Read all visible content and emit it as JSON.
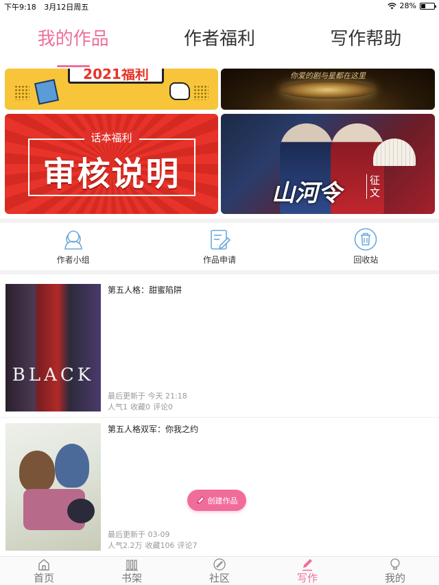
{
  "status_bar": {
    "time": "下午9:18",
    "date": "3月12日周五",
    "battery": "28%"
  },
  "top_tabs": [
    {
      "label": "我的作品",
      "active": true
    },
    {
      "label": "作者福利",
      "active": false
    },
    {
      "label": "写作帮助",
      "active": false
    }
  ],
  "banners": {
    "b1_title": "2021福利",
    "b2_text": "你爱的剧与星都在这里",
    "b3_label": "话本福利",
    "b3_title": "审核说明",
    "b4_title": "山河令",
    "b4_sub": "征文"
  },
  "quick_actions": [
    {
      "label": "作者小组",
      "icon": "author-group-icon"
    },
    {
      "label": "作品申请",
      "icon": "work-apply-icon"
    },
    {
      "label": "回收站",
      "icon": "recycle-bin-icon"
    }
  ],
  "works": [
    {
      "title": "第五人格：甜蜜陷阱",
      "cover_text": "BLACK",
      "updated": "最后更新于 今天 21:18",
      "stats": {
        "popularity": "人气1",
        "favorites": "收藏0",
        "comments": "评论0"
      }
    },
    {
      "title": "第五人格双军：你我之约",
      "updated": "最后更新于 03-09",
      "stats": {
        "popularity": "人气2.2万",
        "favorites": "收藏106",
        "comments": "评论7"
      }
    }
  ],
  "create_button": {
    "label": "创建作品",
    "icon": "pencil-icon"
  },
  "bottom_nav": [
    {
      "label": "首页",
      "icon": "home-icon",
      "active": false
    },
    {
      "label": "书架",
      "icon": "bookshelf-icon",
      "active": false
    },
    {
      "label": "社区",
      "icon": "community-icon",
      "active": false
    },
    {
      "label": "写作",
      "icon": "write-icon",
      "active": true
    },
    {
      "label": "我的",
      "icon": "profile-icon",
      "active": false
    }
  ],
  "colors": {
    "accent": "#ee6f9a",
    "button": "#f06c9b",
    "icon_blue": "#6aa9dc"
  }
}
